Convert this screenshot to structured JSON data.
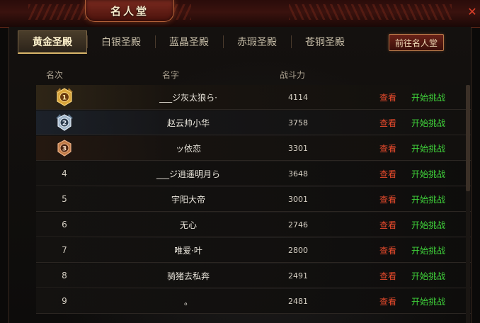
{
  "window": {
    "title": "名人堂",
    "close_icon": "close-icon"
  },
  "tabs": [
    {
      "label": "黄金圣殿",
      "active": true
    },
    {
      "label": "白银圣殿",
      "active": false
    },
    {
      "label": "蓝晶圣殿",
      "active": false
    },
    {
      "label": "赤瑕圣殿",
      "active": false
    },
    {
      "label": "苍铜圣殿",
      "active": false
    }
  ],
  "goto_button": "前往名人堂",
  "columns": {
    "rank": "名次",
    "name": "名字",
    "power": "战斗力"
  },
  "rows": [
    {
      "rank": "1",
      "medal": "gold-medal-icon",
      "name": "___ジ灰太狼ら·",
      "power": "4114",
      "view": "查看",
      "challenge": "开始挑战"
    },
    {
      "rank": "2",
      "medal": "silver-medal-icon",
      "name": "赵云帅小华",
      "power": "3758",
      "view": "查看",
      "challenge": "开始挑战"
    },
    {
      "rank": "3",
      "medal": "bronze-medal-icon",
      "name": "ッ依恋",
      "power": "3301",
      "view": "查看",
      "challenge": "开始挑战"
    },
    {
      "rank": "4",
      "name": "___ジ逍遥明月ら",
      "power": "3648",
      "view": "查看",
      "challenge": "开始挑战"
    },
    {
      "rank": "5",
      "name": "宇阳大帝",
      "power": "3001",
      "view": "查看",
      "challenge": "开始挑战"
    },
    {
      "rank": "6",
      "name": "无心",
      "power": "2746",
      "view": "查看",
      "challenge": "开始挑战"
    },
    {
      "rank": "7",
      "name": "唯爱·叶",
      "power": "2800",
      "view": "查看",
      "challenge": "开始挑战"
    },
    {
      "rank": "8",
      "name": "骑猪去私奔",
      "power": "2491",
      "view": "查看",
      "challenge": "开始挑战"
    },
    {
      "rank": "9",
      "name": "。",
      "power": "2481",
      "view": "查看",
      "challenge": "开始挑战"
    }
  ],
  "colors": {
    "view": "#e84a2c",
    "challenge": "#3fd23a",
    "gold": "#d9a43a",
    "silver": "#9fb4c8",
    "bronze": "#c07a45"
  }
}
